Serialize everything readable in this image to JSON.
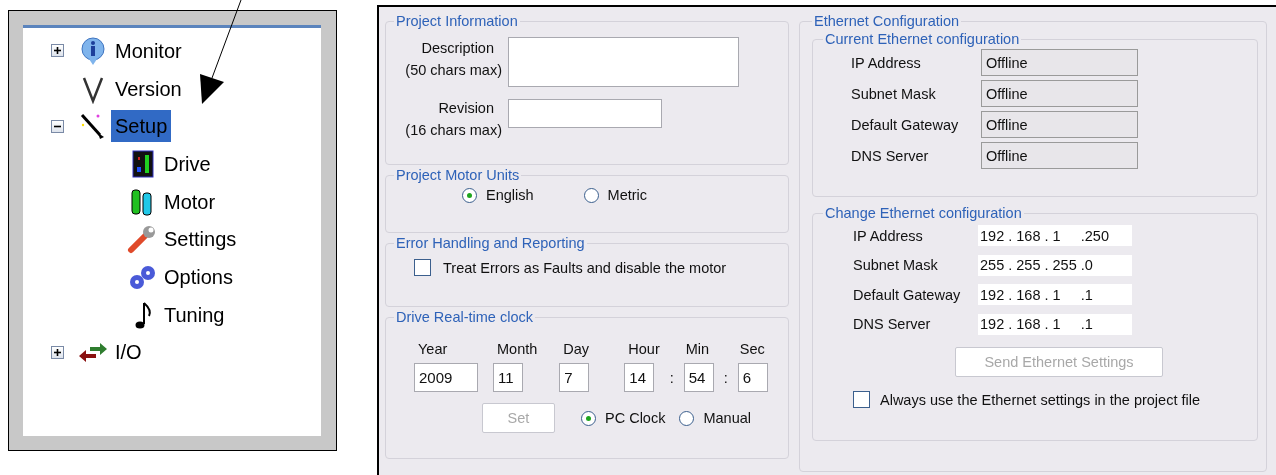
{
  "tree": {
    "items": [
      {
        "label": "Monitor",
        "expanded": false,
        "selected": false
      },
      {
        "label": "Version",
        "selected": false
      },
      {
        "label": "Setup",
        "expanded": true,
        "selected": true,
        "children": [
          {
            "label": "Drive",
            "selected": false
          },
          {
            "label": "Motor",
            "selected": false
          },
          {
            "label": "Settings",
            "selected": false
          },
          {
            "label": "Options",
            "selected": false
          },
          {
            "label": "Tuning",
            "selected": false
          }
        ]
      },
      {
        "label": "I/O",
        "expanded": false,
        "selected": false
      }
    ]
  },
  "project_information": {
    "title": "Project Information",
    "fields": [
      {
        "label": "Description",
        "hint": "(50 chars max)",
        "kind": "wide"
      },
      {
        "label": "Revision",
        "hint": "(16 chars max)",
        "kind": "narrow"
      }
    ]
  },
  "project_motor_units": {
    "title": "Project Motor Units",
    "options": [
      {
        "label": "English",
        "selected": true
      },
      {
        "label": "Metric",
        "selected": false
      }
    ]
  },
  "error_handling": {
    "title": "Error Handling and Reporting",
    "checkbox": {
      "label": "Treat Errors as Faults and disable the motor",
      "checked": false
    }
  },
  "drive_clock": {
    "title": "Drive Real-time clock",
    "fields": [
      {
        "label": "Year",
        "value": "2009"
      },
      {
        "label": "Month",
        "value": "11"
      },
      {
        "label": "Day",
        "value": "7"
      },
      {
        "label": "Hour",
        "value": "14"
      },
      {
        "label": "Min",
        "value": "54",
        "separator": ":"
      },
      {
        "label": "Sec",
        "value": "6",
        "separator": ":"
      }
    ],
    "set_button": {
      "label": "Set",
      "disabled": true
    },
    "sources": [
      {
        "label": "PC Clock",
        "selected": true
      },
      {
        "label": "Manual",
        "selected": false
      }
    ]
  },
  "ethernet": {
    "title": "Ethernet Configuration",
    "current": {
      "title": "Current Ethernet configuration",
      "rows": [
        {
          "label": "IP Address",
          "value": "Offline"
        },
        {
          "label": "Subnet Mask",
          "value": "Offline"
        },
        {
          "label": "Default Gateway",
          "value": "Offline"
        },
        {
          "label": "DNS Server",
          "value": "Offline"
        }
      ]
    },
    "change": {
      "title": "Change Ethernet configuration",
      "rows": [
        {
          "label": "IP Address",
          "value": "192 . 168 . 1     .250"
        },
        {
          "label": "Subnet Mask",
          "value": "255 . 255 . 255 .0"
        },
        {
          "label": "Default Gateway",
          "value": "192 . 168 . 1     .1"
        },
        {
          "label": "DNS Server",
          "value": "192 . 168 . 1     .1"
        }
      ],
      "send_button": {
        "label": "Send Ethernet Settings",
        "disabled": true
      },
      "checkbox": {
        "label": "Always use the Ethernet settings in the project file",
        "checked": false
      }
    }
  }
}
